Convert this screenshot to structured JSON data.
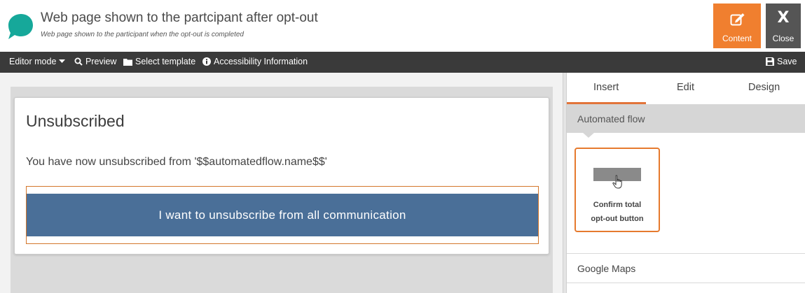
{
  "header": {
    "title": "Web page shown to the partcipant after opt-out",
    "subtitle": "Web page shown to the participant when the opt-out is completed",
    "content_label": "Content",
    "close_glyph": "X",
    "close_label": "Close",
    "accent_color": "#f07f2f",
    "logo_icon": "speech-bubble-icon"
  },
  "toolbar": {
    "editor_mode": "Editor mode",
    "preview": "Preview",
    "select_template": "Select template",
    "accessibility": "Accessibility Information",
    "save": "Save"
  },
  "canvas": {
    "heading": "Unsubscribed",
    "message": "You have now unsubscribed from '$$automatedflow.name$$'",
    "button_label": "I want to unsubscribe from all communication",
    "button_color": "#4a6f98"
  },
  "panel": {
    "tabs": [
      {
        "label": "Insert",
        "active": true
      },
      {
        "label": "Edit",
        "active": false
      },
      {
        "label": "Design",
        "active": false
      }
    ],
    "section_title": "Automated flow",
    "widget_label_line1": "Confirm total",
    "widget_label_line2": "opt-out button",
    "next_section": "Google Maps"
  }
}
